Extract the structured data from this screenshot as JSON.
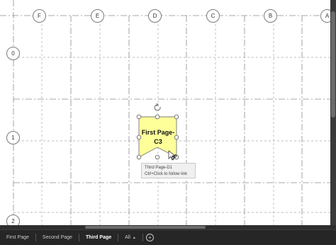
{
  "grid": {
    "columns": [
      "F",
      "E",
      "D",
      "C",
      "B",
      "A"
    ],
    "rows": [
      "0",
      "1",
      "2"
    ]
  },
  "shape": {
    "line1": "First Page-",
    "line2": "C3",
    "fill_color": "#ffff99"
  },
  "tooltip": {
    "link": "Third Page-D1",
    "hint": "Ctrl+Click to follow link"
  },
  "tabs": {
    "items": [
      "First Page",
      "Second Page",
      "Third Page"
    ],
    "active": "Third Page",
    "all_label": "All",
    "add_icon": "plus-circle-icon"
  }
}
